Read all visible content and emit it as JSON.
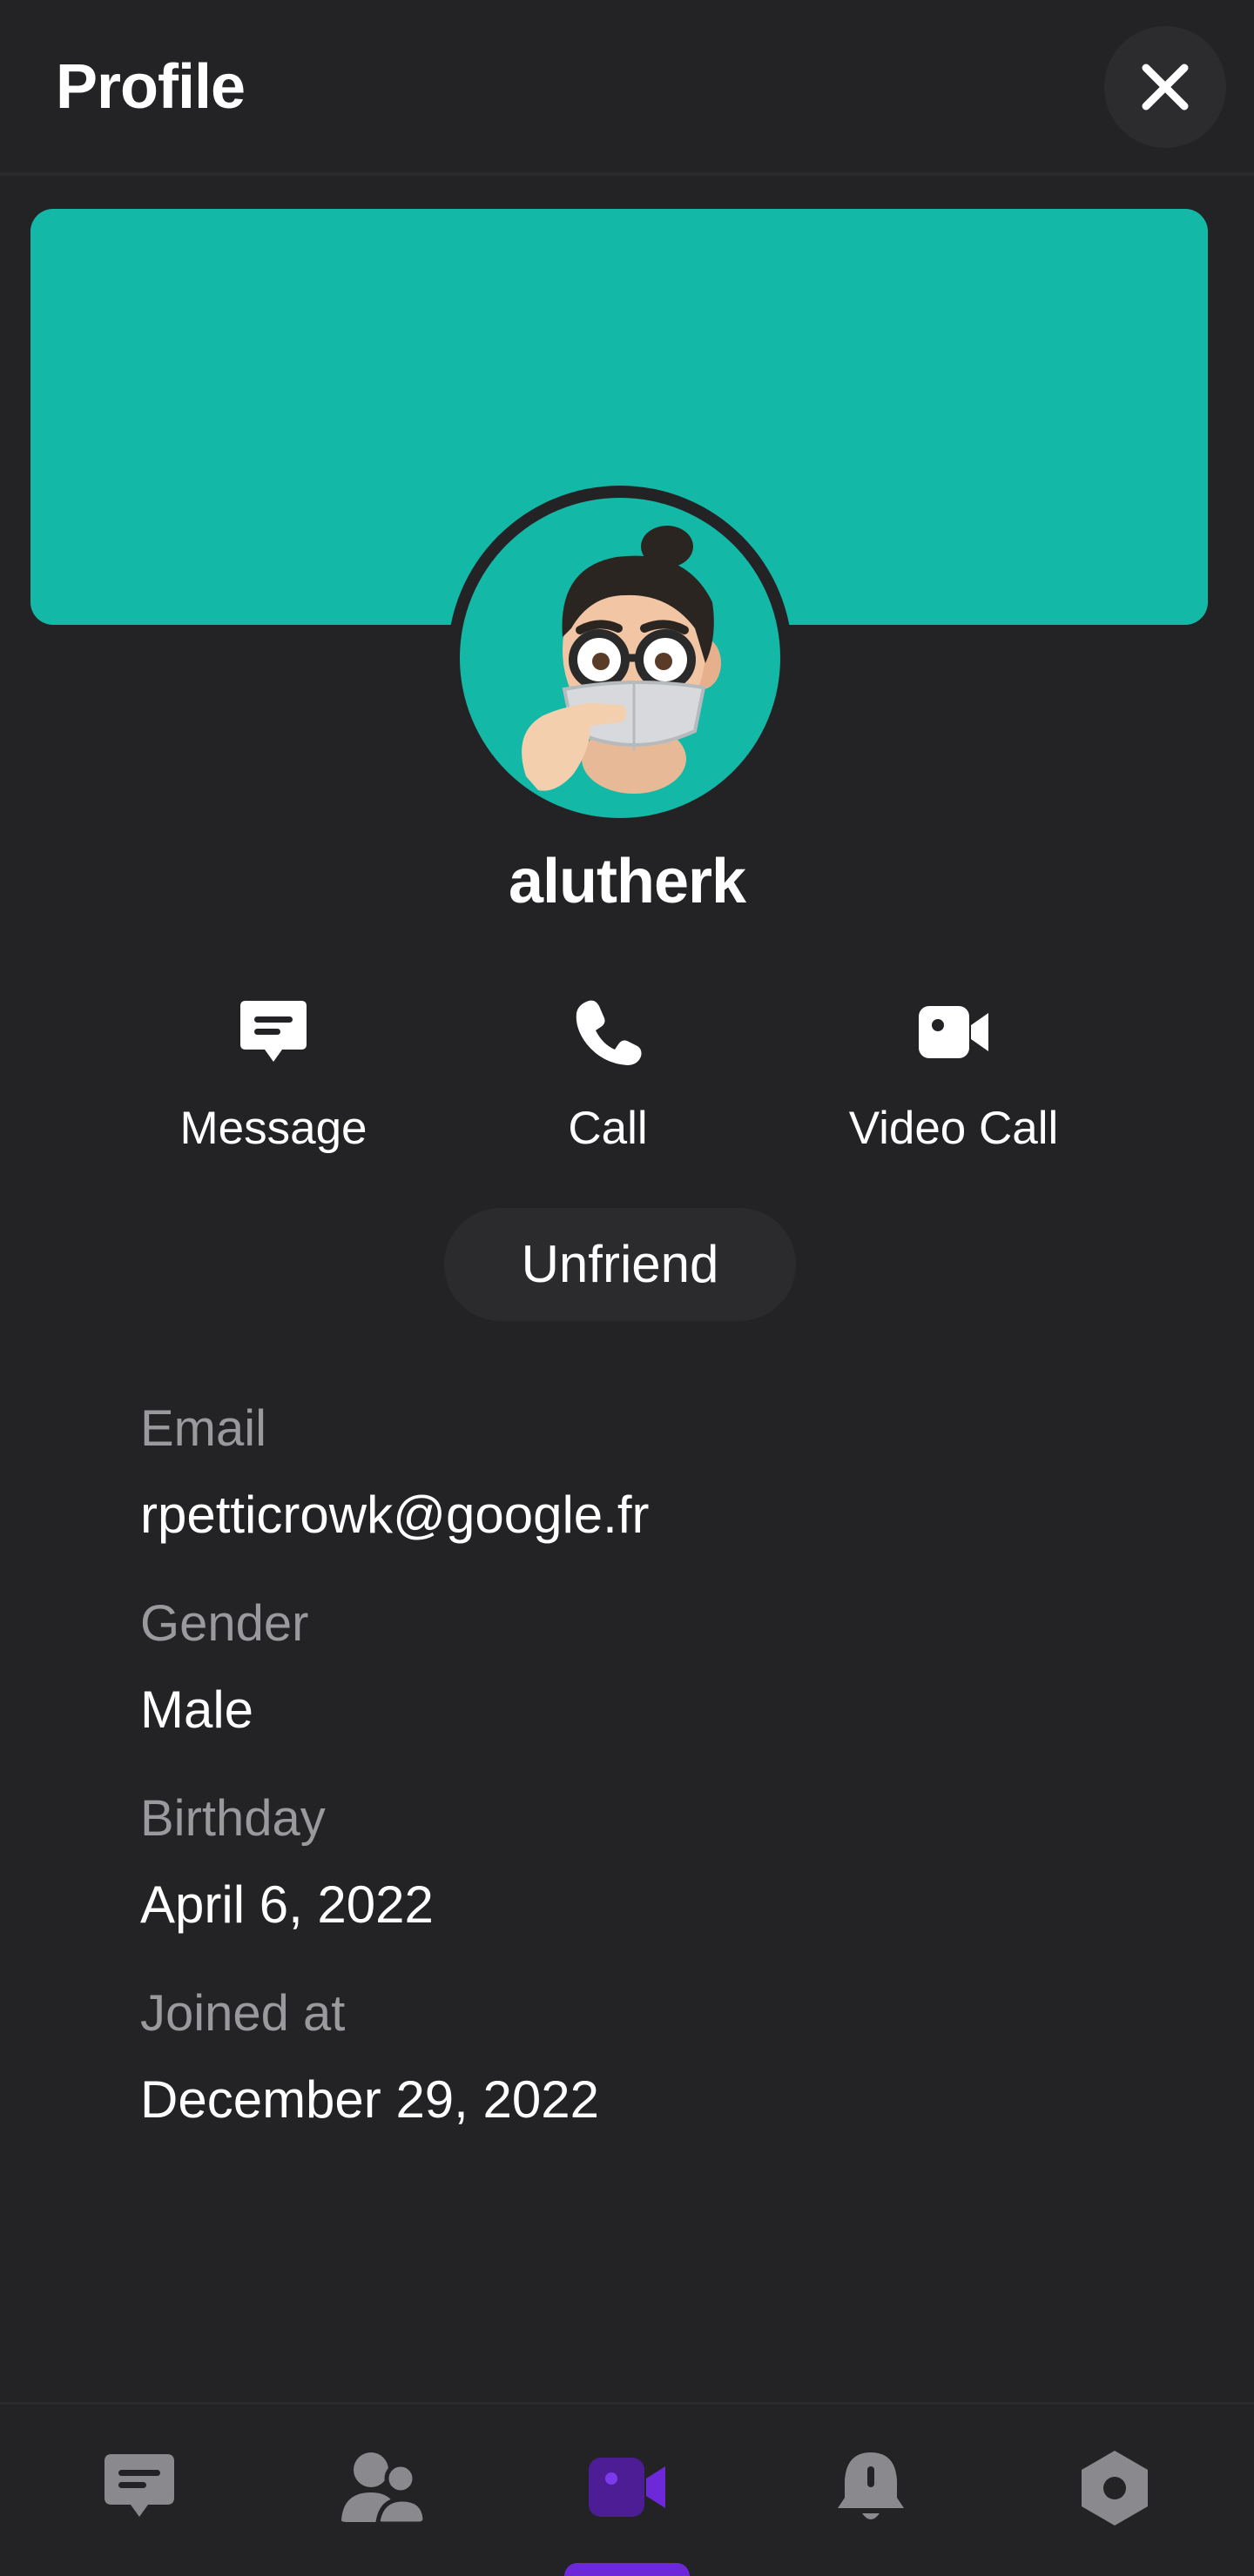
{
  "header": {
    "title": "Profile"
  },
  "profile": {
    "username": "alutherk"
  },
  "actions": [
    {
      "label": "Message",
      "icon": "message-icon"
    },
    {
      "label": "Call",
      "icon": "phone-icon"
    },
    {
      "label": "Video Call",
      "icon": "video-camera-icon"
    }
  ],
  "unfriend_label": "Unfriend",
  "info": [
    {
      "key": "Email",
      "value": "rpetticrowk@google.fr"
    },
    {
      "key": "Gender",
      "value": "Male"
    },
    {
      "key": "Birthday",
      "value": "April 6, 2022"
    },
    {
      "key": "Joined at",
      "value": "December 29, 2022"
    }
  ],
  "bottom_nav": [
    {
      "icon": "chat-icon",
      "active": false
    },
    {
      "icon": "friends-icon",
      "active": false
    },
    {
      "icon": "video-icon",
      "active": true
    },
    {
      "icon": "notification-bell-icon",
      "active": false
    },
    {
      "icon": "settings-hexagon-icon",
      "active": false
    }
  ],
  "colors": {
    "background": "#232325",
    "cover": "#14b8a6",
    "accent": "#6d28d9",
    "muted_text": "#9a9a9e"
  }
}
